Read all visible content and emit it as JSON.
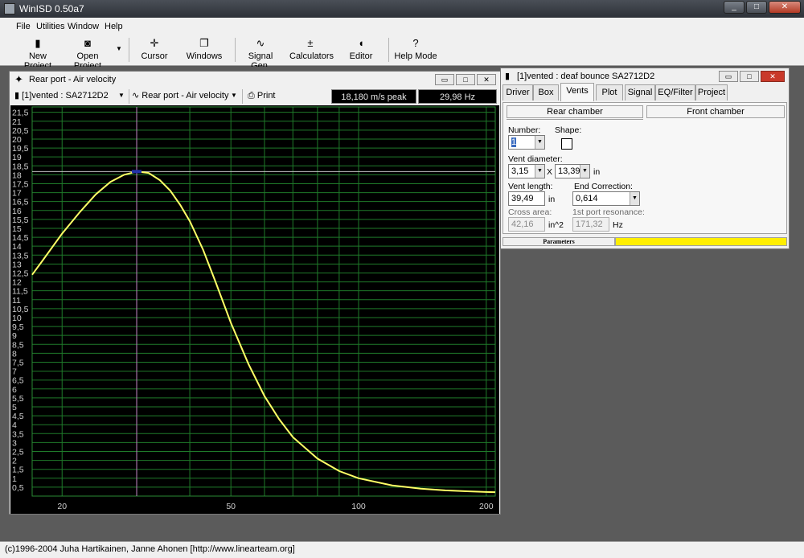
{
  "app": {
    "title": "WinISD 0.50a7"
  },
  "menu": [
    "File",
    "Utilities",
    "Window",
    "Help"
  ],
  "toolbar": [
    {
      "label": "New Project",
      "icon": "new-project-icon"
    },
    {
      "label": "Open Project",
      "icon": "open-project-icon"
    },
    {
      "label": "Cursor",
      "icon": "cursor-icon"
    },
    {
      "label": "Windows",
      "icon": "windows-icon"
    },
    {
      "label": "Signal Gen.",
      "icon": "signal-gen-icon"
    },
    {
      "label": "Calculators",
      "icon": "calculators-icon"
    },
    {
      "label": "Editor",
      "icon": "editor-icon"
    },
    {
      "label": "Help Mode",
      "icon": "help-icon"
    }
  ],
  "plot_window": {
    "title": "Rear port - Air velocity",
    "project_select": "[1]vented : SA2712D2",
    "graph_select": "Rear port - Air velocity",
    "print_label": "Print",
    "peak_readout": "18,180 m/s peak",
    "freq_readout": "29,98 Hz"
  },
  "chart_data": {
    "type": "line",
    "xscale": "log",
    "xlim": [
      17,
      210
    ],
    "ylim": [
      0,
      21.8
    ],
    "x_tick_labels": [
      "20",
      "50",
      "100",
      "200"
    ],
    "y_tick_labels": [
      "21,5",
      "21",
      "20,5",
      "20",
      "19,5",
      "19",
      "18,5",
      "18",
      "17,5",
      "17",
      "16,5",
      "16",
      "15,5",
      "15",
      "14,5",
      "14",
      "13,5",
      "13",
      "12,5",
      "12",
      "11,5",
      "11",
      "10,5",
      "10",
      "9,5",
      "9",
      "8,5",
      "8",
      "7,5",
      "7",
      "6,5",
      "6",
      "5,5",
      "5",
      "4,5",
      "4",
      "3,5",
      "3",
      "2,5",
      "2",
      "1,5",
      "1",
      "0,5"
    ],
    "cursor_x": 29.98,
    "cursor_y": 18.18,
    "series": [
      {
        "color": "#ffff66",
        "x": [
          17,
          18,
          20,
          22,
          24,
          26,
          28,
          29.98,
          32,
          34,
          36,
          38,
          40,
          43,
          46,
          50,
          55,
          60,
          65,
          70,
          80,
          90,
          100,
          120,
          140,
          160,
          180,
          200,
          210
        ],
        "y": [
          12.4,
          13.2,
          14.7,
          15.9,
          16.9,
          17.6,
          18.0,
          18.18,
          18.1,
          17.7,
          17.1,
          16.3,
          15.4,
          13.8,
          12.0,
          9.7,
          7.4,
          5.6,
          4.3,
          3.3,
          2.1,
          1.4,
          1.0,
          0.6,
          0.42,
          0.32,
          0.27,
          0.23,
          0.22
        ]
      }
    ]
  },
  "params_window": {
    "title": "[1]vented : deaf bounce SA2712D2",
    "tabs": [
      "Driver",
      "Box",
      "Vents",
      "Plot",
      "Signal",
      "EQ/Filter",
      "Project"
    ],
    "active_tab": "Vents",
    "rear_chamber": "Rear chamber",
    "front_chamber": "Front chamber",
    "number_label": "Number:",
    "number_value": "1",
    "shape_label": "Shape:",
    "vent_diameter_label": "Vent diameter:",
    "vent_d1": "3,15",
    "vent_x": "X",
    "vent_d2": "13,39",
    "vent_d_unit": "in",
    "vent_length_label": "Vent length:",
    "vent_length": "39,49",
    "vent_length_unit": "in",
    "end_corr_label": "End Correction:",
    "end_corr": "0,614",
    "cross_area_label": "Cross area:",
    "cross_area": "42,16",
    "cross_area_unit": "in^2",
    "resonance_label": "1st port resonance:",
    "resonance": "171,32",
    "resonance_unit": "Hz",
    "status_label": "Parameters"
  },
  "statusbar": "(c)1996-2004 Juha Hartikainen, Janne Ahonen [http://www.linearteam.org]"
}
